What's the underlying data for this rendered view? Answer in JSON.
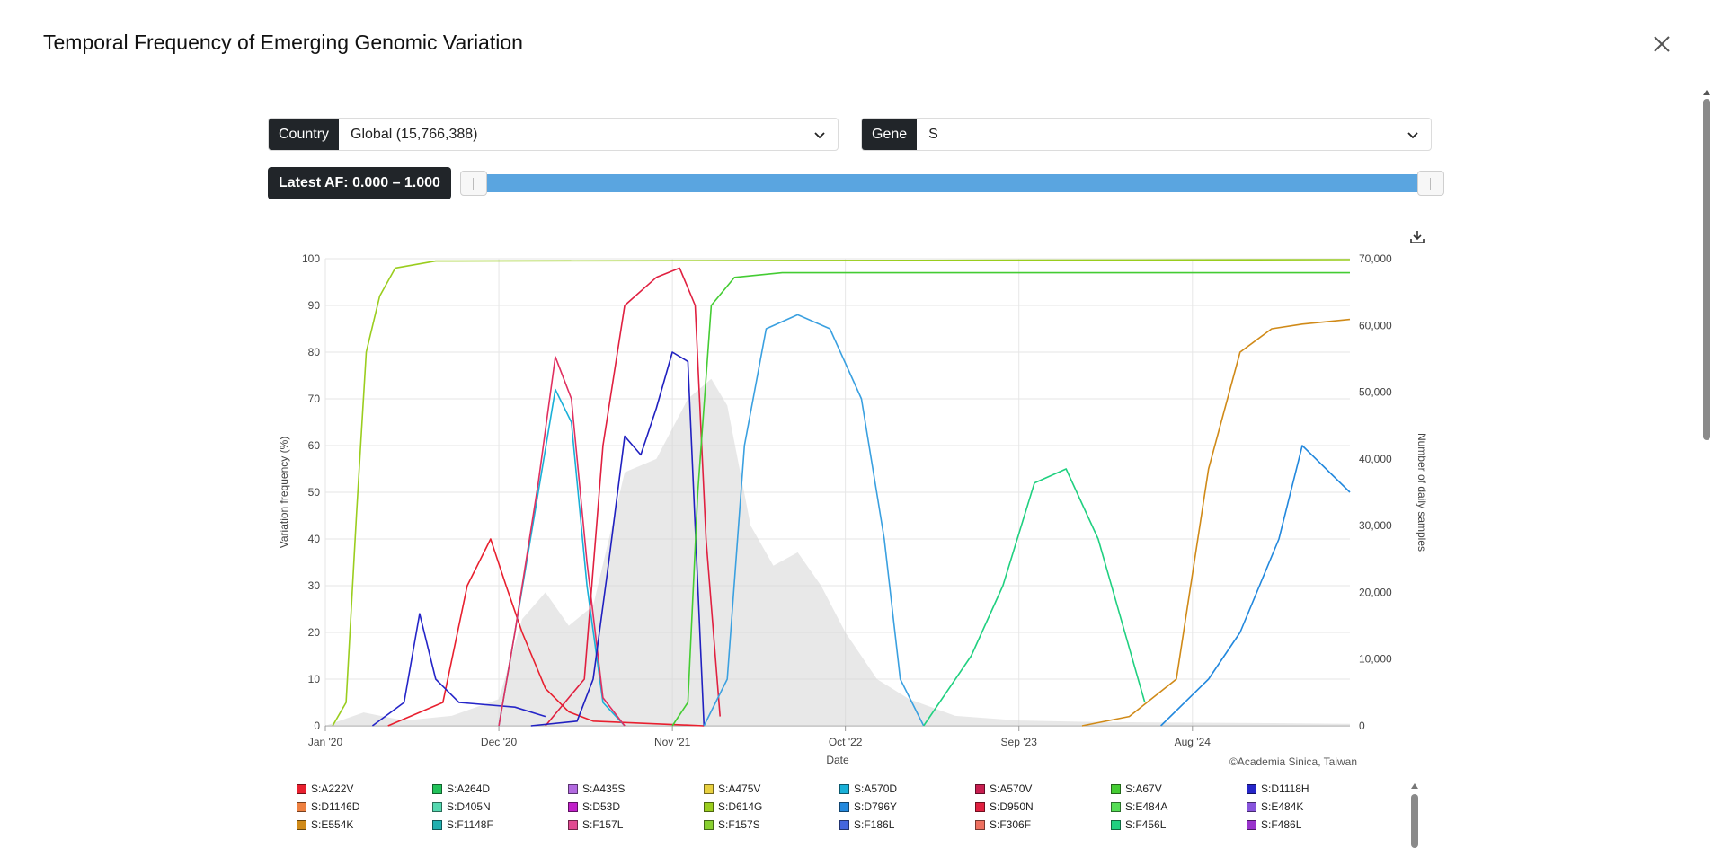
{
  "modal": {
    "title": "Temporal Frequency of Emerging Genomic Variation"
  },
  "filters": {
    "country_label": "Country",
    "country_value": "Global (15,766,388)",
    "gene_label": "Gene",
    "gene_value": "S",
    "af_label": "Latest AF: 0.000 – 1.000",
    "af_range": [
      0.0,
      1.0
    ]
  },
  "icons": {
    "close": "close-icon",
    "chevron": "chevron-down-icon",
    "download": "download-icon"
  },
  "chart_data": {
    "type": "line",
    "xlabel": "Date",
    "ylabel": "Variation frequency (%)",
    "y2label": "Number of daily samples",
    "ylim": [
      0,
      100
    ],
    "y2lim": [
      0,
      70000
    ],
    "xlim": [
      "2020-01-01",
      "2025-06-01"
    ],
    "x_ticks": [
      "Jan '20",
      "Dec '20",
      "Nov '21",
      "Oct '22",
      "Sep '23",
      "Aug '24"
    ],
    "x_tick_dates": [
      "2020-01-01",
      "2020-12-01",
      "2021-11-01",
      "2022-10-01",
      "2023-09-01",
      "2024-08-01"
    ],
    "y_ticks": [
      0,
      10,
      20,
      30,
      40,
      50,
      60,
      70,
      80,
      90,
      100
    ],
    "y2_ticks": [
      0,
      10000,
      20000,
      30000,
      40000,
      50000,
      60000,
      70000
    ],
    "y2_tick_labels": [
      "0",
      "10,000",
      "20,000",
      "30,000",
      "40,000",
      "50,000",
      "60,000",
      "70,000"
    ],
    "grid": true,
    "credit": "©Academia Sinica, Taiwan",
    "daily_samples": {
      "x": [
        "2020-01-01",
        "2020-03-15",
        "2020-06-01",
        "2020-09-01",
        "2020-12-01",
        "2021-01-15",
        "2021-03-01",
        "2021-04-15",
        "2021-06-01",
        "2021-08-01",
        "2021-10-01",
        "2021-12-01",
        "2022-01-15",
        "2022-02-15",
        "2022-04-01",
        "2022-05-15",
        "2022-07-01",
        "2022-08-15",
        "2022-10-01",
        "2022-12-01",
        "2023-02-01",
        "2023-05-01",
        "2023-09-01",
        "2024-01-01",
        "2024-06-01",
        "2025-01-01",
        "2025-06-01"
      ],
      "values": [
        0,
        2000,
        800,
        1500,
        4000,
        16000,
        20000,
        15000,
        18000,
        38000,
        40000,
        49000,
        52000,
        48000,
        30000,
        24000,
        26000,
        21000,
        14000,
        7000,
        4000,
        1500,
        800,
        600,
        500,
        400,
        300
      ]
    },
    "series": [
      {
        "name": "S:D614G",
        "color": "#9acd1e",
        "x": [
          "2020-01-15",
          "2020-02-10",
          "2020-03-01",
          "2020-03-20",
          "2020-04-15",
          "2020-05-15",
          "2020-08-01",
          "2025-06-01"
        ],
        "values": [
          0,
          5,
          45,
          80,
          92,
          98,
          99.5,
          99.8
        ]
      },
      {
        "name": "S:A222V",
        "color": "#e8202f",
        "x": [
          "2020-05-01",
          "2020-08-15",
          "2020-10-01",
          "2020-11-15",
          "2020-12-15",
          "2021-01-15",
          "2021-03-01",
          "2021-04-15",
          "2021-06-01",
          "2022-01-01"
        ],
        "values": [
          0,
          5,
          30,
          40,
          30,
          20,
          8,
          3,
          1,
          0
        ]
      },
      {
        "name": "S:D1118H",
        "color": "#2525c8",
        "x": [
          "2020-04-01",
          "2020-06-01",
          "2020-07-01",
          "2020-08-01",
          "2020-09-15",
          "2021-01-01",
          "2021-03-01"
        ],
        "values": [
          0,
          5,
          24,
          10,
          5,
          4,
          2
        ]
      },
      {
        "name": "S:A570D",
        "color": "#19b0d8",
        "x": [
          "2020-12-01",
          "2021-01-01",
          "2021-02-15",
          "2021-03-20",
          "2021-04-20",
          "2021-05-20",
          "2021-06-20",
          "2021-08-01"
        ],
        "values": [
          0,
          20,
          50,
          72,
          65,
          30,
          5,
          0
        ]
      },
      {
        "name": "S:A570V",
        "color": "#e03060",
        "x": [
          "2020-12-01",
          "2021-01-01",
          "2021-02-15",
          "2021-03-20",
          "2021-04-20",
          "2021-05-20",
          "2021-06-20",
          "2021-08-01"
        ],
        "values": [
          0,
          20,
          52,
          79,
          70,
          35,
          6,
          0
        ]
      },
      {
        "name": "S:D950N",
        "color": "#e02040",
        "x": [
          "2021-03-01",
          "2021-05-15",
          "2021-06-20",
          "2021-08-01",
          "2021-10-01",
          "2021-11-15",
          "2021-12-15",
          "2022-01-05",
          "2022-02-01"
        ],
        "values": [
          0,
          10,
          60,
          90,
          96,
          98,
          90,
          40,
          2
        ]
      },
      {
        "name": "S:E484K",
        "color": "#2020c0",
        "x": [
          "2021-02-01",
          "2021-05-01",
          "2021-06-01",
          "2021-07-01",
          "2021-08-01",
          "2021-09-01",
          "2021-10-01",
          "2021-11-01",
          "2021-12-01",
          "2022-01-01"
        ],
        "values": [
          0,
          1,
          10,
          35,
          62,
          58,
          68,
          80,
          78,
          0
        ]
      },
      {
        "name": "S:A67V",
        "color": "#44cc33",
        "x": [
          "2021-11-01",
          "2021-12-01",
          "2021-12-20",
          "2022-01-15",
          "2022-03-01",
          "2022-06-01",
          "2023-01-01",
          "2024-06-01",
          "2025-06-01"
        ],
        "values": [
          0,
          5,
          50,
          90,
          96,
          97,
          97,
          97,
          97
        ]
      },
      {
        "name": "S:F186L",
        "color": "#3aa0e0",
        "x": [
          "2022-01-01",
          "2022-02-15",
          "2022-03-20",
          "2022-05-01",
          "2022-07-01",
          "2022-09-01",
          "2022-11-01",
          "2022-12-15",
          "2023-01-15",
          "2023-03-01"
        ],
        "values": [
          0,
          10,
          60,
          85,
          88,
          85,
          70,
          40,
          10,
          0
        ]
      },
      {
        "name": "S:E554K",
        "color": "#d08a18",
        "x": [
          "2024-01-01",
          "2024-04-01",
          "2024-07-01",
          "2024-09-01",
          "2024-11-01",
          "2025-01-01",
          "2025-03-01",
          "2025-06-01"
        ],
        "values": [
          0,
          2,
          10,
          55,
          80,
          85,
          86,
          87
        ]
      },
      {
        "name": "S:F456L",
        "color": "#20d080",
        "x": [
          "2023-03-01",
          "2023-06-01",
          "2023-08-01",
          "2023-10-01",
          "2023-12-01",
          "2024-02-01",
          "2024-05-01"
        ],
        "values": [
          0,
          15,
          30,
          52,
          55,
          40,
          5
        ]
      },
      {
        "name": "S:D796Y",
        "color": "#2288dd",
        "x": [
          "2024-06-01",
          "2024-09-01",
          "2024-11-01",
          "2025-01-15",
          "2025-03-01",
          "2025-06-01"
        ],
        "values": [
          0,
          10,
          20,
          40,
          60,
          50
        ]
      }
    ]
  },
  "legend": {
    "items": [
      {
        "label": "S:A222V",
        "color": "#e8202f"
      },
      {
        "label": "S:A264D",
        "color": "#22c25a"
      },
      {
        "label": "S:A435S",
        "color": "#b26ae0"
      },
      {
        "label": "S:A475V",
        "color": "#e8d040"
      },
      {
        "label": "S:A570D",
        "color": "#19b0d8"
      },
      {
        "label": "S:A570V",
        "color": "#c81e50"
      },
      {
        "label": "S:A67V",
        "color": "#44cc33"
      },
      {
        "label": "S:D1118H",
        "color": "#2525c8"
      },
      {
        "label": "S:D1146D",
        "color": "#ee8040"
      },
      {
        "label": "S:D405N",
        "color": "#55d8b0"
      },
      {
        "label": "S:D53D",
        "color": "#c020c8"
      },
      {
        "label": "S:D614G",
        "color": "#9acd1e"
      },
      {
        "label": "S:D796Y",
        "color": "#2288dd"
      },
      {
        "label": "S:D950N",
        "color": "#e02040"
      },
      {
        "label": "S:E484A",
        "color": "#55dd55"
      },
      {
        "label": "S:E484K",
        "color": "#8855dd"
      },
      {
        "label": "S:E554K",
        "color": "#d08a18"
      },
      {
        "label": "S:F1148F",
        "color": "#20b0b0"
      },
      {
        "label": "S:F157L",
        "color": "#e04890"
      },
      {
        "label": "S:F157S",
        "color": "#88d030"
      },
      {
        "label": "S:F186L",
        "color": "#4466dd"
      },
      {
        "label": "S:F306F",
        "color": "#ee7060"
      },
      {
        "label": "S:F456L",
        "color": "#20d080"
      },
      {
        "label": "S:F486L",
        "color": "#9933cc"
      }
    ]
  }
}
